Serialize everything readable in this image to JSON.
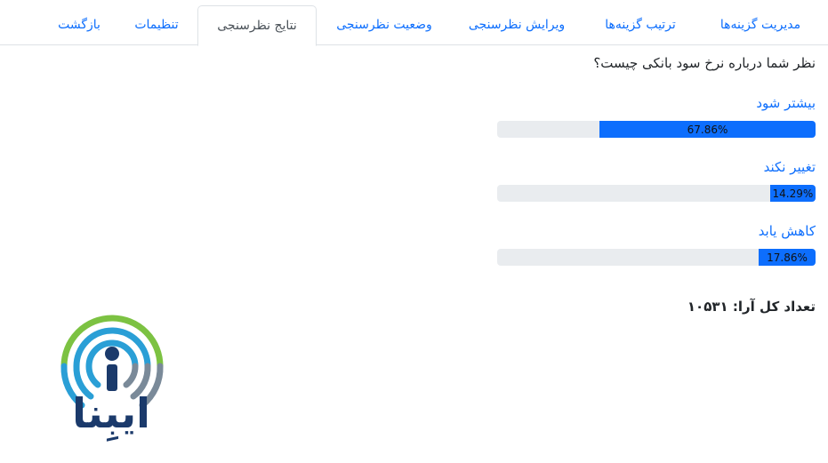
{
  "tabs": [
    {
      "label": "مدیریت گزینه‌ها",
      "active": false
    },
    {
      "label": "ترتیب گزینه‌ها",
      "active": false
    },
    {
      "label": "ویرایش نظرسنجی",
      "active": false
    },
    {
      "label": "وضعیت نظرسنجی",
      "active": false
    },
    {
      "label": "نتایج نظرسنجی",
      "active": true
    },
    {
      "label": "تنظیمات",
      "active": false
    },
    {
      "label": "بازگشت",
      "active": false
    }
  ],
  "question": "نظر شما درباره نرخ سود بانکی چیست؟",
  "options": [
    {
      "label": "بیشتر شود",
      "percent_text": "67.86%",
      "fraction": 0.6786
    },
    {
      "label": "تغییر نکند",
      "percent_text": "14.29%",
      "fraction": 0.1429
    },
    {
      "label": "کاهش یابد",
      "percent_text": "17.86%",
      "fraction": 0.1786
    }
  ],
  "total": "تعداد کل آرا: ۱۰۵۳۱",
  "logo": {
    "text": "ایبِنا",
    "colors": {
      "green": "#7cc242",
      "blue": "#2a9fd6",
      "navy": "#1b3a6b"
    }
  },
  "colors": {
    "accent": "#0d6efd",
    "track": "#e9ecef"
  }
}
